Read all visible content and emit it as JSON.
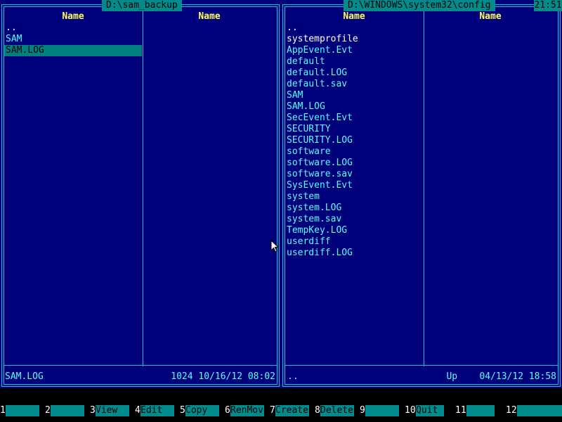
{
  "clock": "21:51",
  "left_panel": {
    "title": "D:\\sam_backup",
    "columns": [
      "Name",
      "Name"
    ],
    "files": [
      {
        "name": "..",
        "style": "white"
      },
      {
        "name": "SAM",
        "style": "normal"
      },
      {
        "name": "SAM.LOG",
        "style": "selected"
      }
    ],
    "status_name": "SAM.LOG",
    "status_info": "1024 10/16/12 08:02"
  },
  "right_panel": {
    "title": "D:\\WINDOWS\\system32\\config",
    "columns": [
      "Name",
      "Name"
    ],
    "files": [
      {
        "name": "..",
        "style": "white"
      },
      {
        "name": "systemprofile",
        "style": "white"
      },
      {
        "name": "AppEvent.Evt",
        "style": "normal"
      },
      {
        "name": "default",
        "style": "normal"
      },
      {
        "name": "default.LOG",
        "style": "normal"
      },
      {
        "name": "default.sav",
        "style": "normal"
      },
      {
        "name": "SAM",
        "style": "normal"
      },
      {
        "name": "SAM.LOG",
        "style": "normal"
      },
      {
        "name": "SecEvent.Evt",
        "style": "normal"
      },
      {
        "name": "SECURITY",
        "style": "normal"
      },
      {
        "name": "SECURITY.LOG",
        "style": "normal"
      },
      {
        "name": "software",
        "style": "normal"
      },
      {
        "name": "software.LOG",
        "style": "normal"
      },
      {
        "name": "software.sav",
        "style": "normal"
      },
      {
        "name": "SysEvent.Evt",
        "style": "normal"
      },
      {
        "name": "system",
        "style": "normal"
      },
      {
        "name": "system.LOG",
        "style": "normal"
      },
      {
        "name": "system.sav",
        "style": "normal"
      },
      {
        "name": "TempKey.LOG",
        "style": "normal"
      },
      {
        "name": "userdiff",
        "style": "normal"
      },
      {
        "name": "userdiff.LOG",
        "style": "normal"
      }
    ],
    "status_name": "..",
    "status_info": "Up    04/13/12 18:58"
  },
  "function_keys": [
    {
      "num": "1",
      "label": ""
    },
    {
      "num": "2",
      "label": ""
    },
    {
      "num": "3",
      "label": "View"
    },
    {
      "num": "4",
      "label": "Edit"
    },
    {
      "num": "5",
      "label": "Copy"
    },
    {
      "num": "6",
      "label": "RenMov"
    },
    {
      "num": "7",
      "label": "Create"
    },
    {
      "num": "8",
      "label": "Delete"
    },
    {
      "num": "9",
      "label": ""
    },
    {
      "num": "10",
      "label": "Quit"
    },
    {
      "num": "11",
      "label": ""
    },
    {
      "num": "12",
      "label": ""
    }
  ],
  "colors": {
    "panel_bg": "#00007a",
    "border": "#00c8d8",
    "header_text": "#ffff55",
    "file_text": "#55ffff",
    "highlight_bg": "#008080",
    "fkey_label_bg": "#008c8c"
  }
}
